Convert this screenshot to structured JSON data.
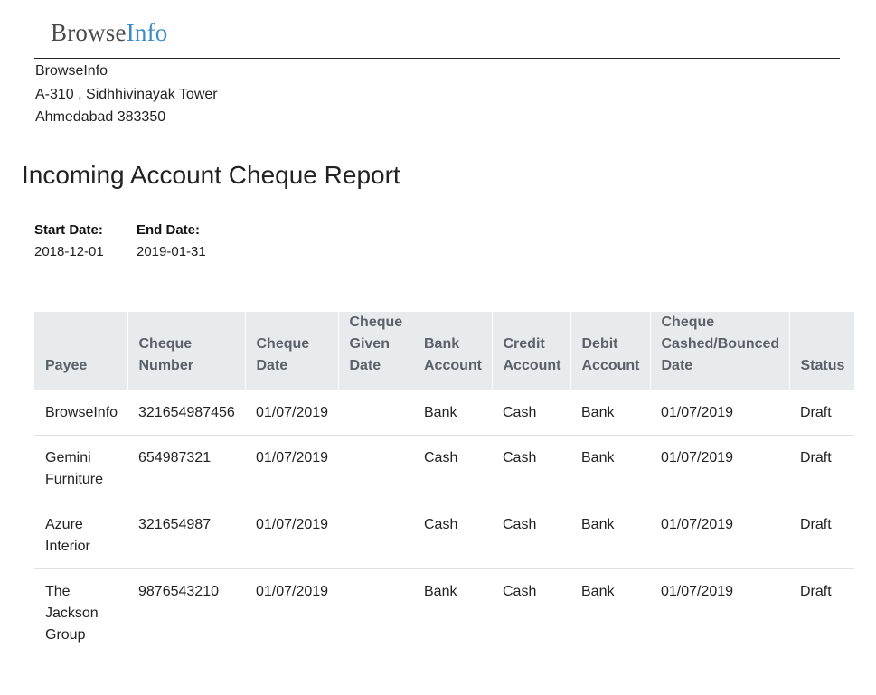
{
  "company": {
    "logo_part1": "Browse",
    "logo_part2": "Info",
    "name": "BrowseInfo",
    "address_line1": "A-310 , Sidhhivinayak Tower",
    "address_line2": "Ahmedabad 383350"
  },
  "report": {
    "title": "Incoming Account Cheque Report",
    "start_date_label": "Start Date:",
    "start_date": "2018-12-01",
    "end_date_label": "End Date:",
    "end_date": "2019-01-31"
  },
  "table": {
    "headers": [
      "Payee",
      "Cheque Number",
      "Cheque Date",
      "Cheque Given Date",
      "Bank Account",
      "Credit Account",
      "Debit Account",
      "Cheque Cashed/Bounced Date",
      "Status"
    ],
    "rows": [
      [
        "BrowseInfo",
        "321654987456",
        "01/07/2019",
        "",
        "Bank",
        "Cash",
        "Bank",
        "01/07/2019",
        "Draft"
      ],
      [
        "Gemini Furniture",
        "654987321",
        "01/07/2019",
        "",
        "Cash",
        "Cash",
        "Bank",
        "01/07/2019",
        "Draft"
      ],
      [
        "Azure Interior",
        "321654987",
        "01/07/2019",
        "",
        "Cash",
        "Cash",
        "Bank",
        "01/07/2019",
        "Draft"
      ],
      [
        "The Jackson Group",
        "9876543210",
        "01/07/2019",
        "",
        "Bank",
        "Cash",
        "Bank",
        "01/07/2019",
        "Draft"
      ]
    ]
  },
  "colors": {
    "logo_info": "#3a8cc9",
    "header_bg": "#e8ebee",
    "header_text": "#5a6168"
  }
}
